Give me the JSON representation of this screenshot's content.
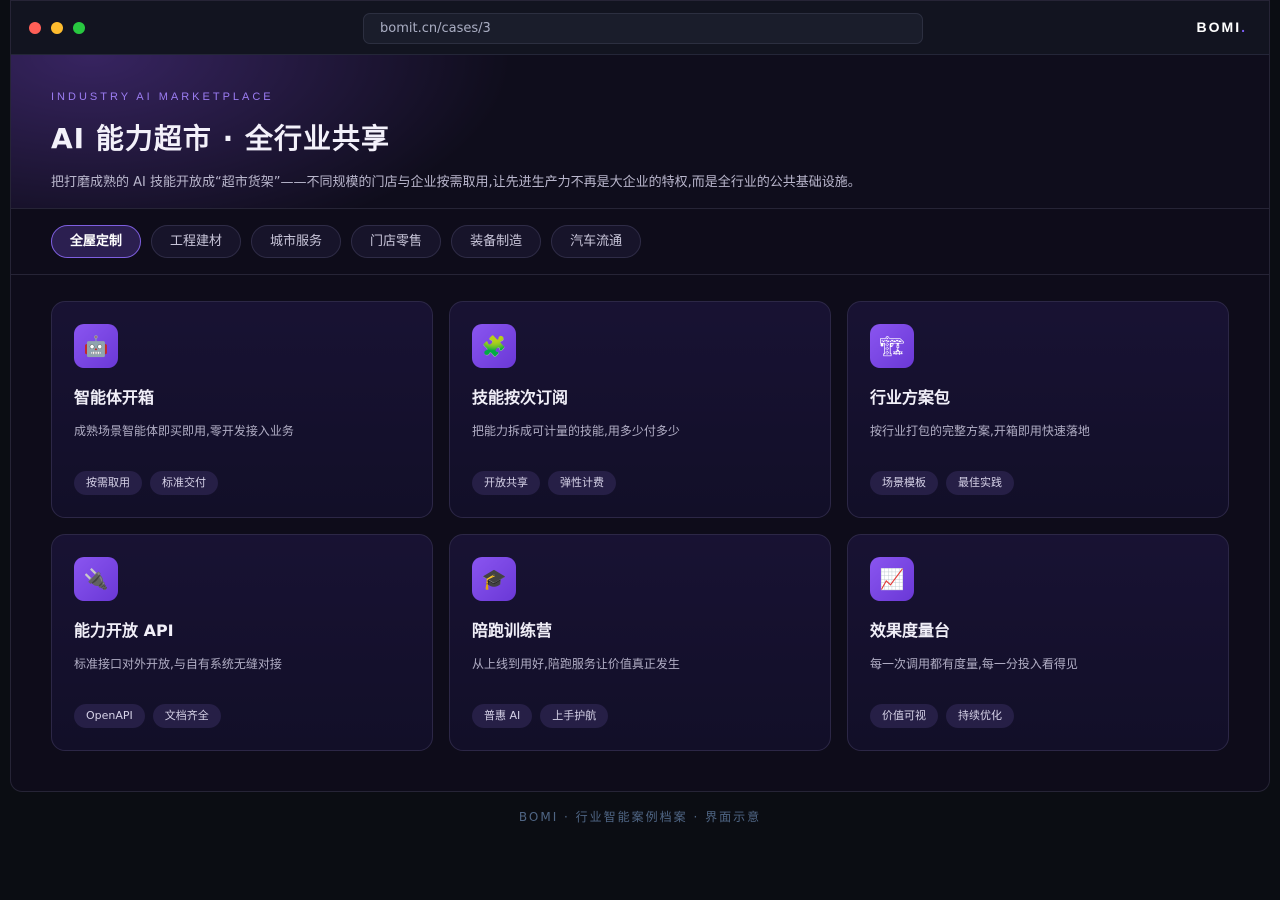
{
  "browser": {
    "url": "bomit.cn/cases/3",
    "brand": "BOMI",
    "brand_dot": "."
  },
  "hero": {
    "eyebrow": "INDUSTRY AI MARKETPLACE",
    "title": "AI 能力超市 · 全行业共享",
    "description": "把打磨成熟的 AI 技能开放成“超市货架”——不同规模的门店与企业按需取用,让先进生产力不再是大企业的特权,而是全行业的公共基础设施。"
  },
  "tabs": [
    {
      "label": "全屋定制",
      "active": true
    },
    {
      "label": "工程建材",
      "active": false
    },
    {
      "label": "城市服务",
      "active": false
    },
    {
      "label": "门店零售",
      "active": false
    },
    {
      "label": "装备制造",
      "active": false
    },
    {
      "label": "汽车流通",
      "active": false
    }
  ],
  "cards": [
    {
      "icon": "robot-icon",
      "glyph": "🤖",
      "title": "智能体开箱",
      "description": "成熟场景智能体即买即用,零开发接入业务",
      "tags": [
        "按需取用",
        "标准交付"
      ]
    },
    {
      "icon": "puzzle-icon",
      "glyph": "🧩",
      "title": "技能按次订阅",
      "description": "把能力拆成可计量的技能,用多少付多少",
      "tags": [
        "开放共享",
        "弹性计费"
      ]
    },
    {
      "icon": "crane-icon",
      "glyph": "🏗",
      "title": "行业方案包",
      "description": "按行业打包的完整方案,开箱即用快速落地",
      "tags": [
        "场景模板",
        "最佳实践"
      ]
    },
    {
      "icon": "plug-icon",
      "glyph": "🔌",
      "title": "能力开放 API",
      "description": "标准接口对外开放,与自有系统无缝对接",
      "tags": [
        "OpenAPI",
        "文档齐全"
      ]
    },
    {
      "icon": "graduation-cap-icon",
      "glyph": "🎓",
      "title": "陪跑训练营",
      "description": "从上线到用好,陪跑服务让价值真正发生",
      "tags": [
        "普惠 AI",
        "上手护航"
      ]
    },
    {
      "icon": "chart-increasing-icon",
      "glyph": "📈",
      "title": "效果度量台",
      "description": "每一次调用都有度量,每一分投入看得见",
      "tags": [
        "价值可视",
        "持续优化"
      ]
    }
  ],
  "footer": {
    "text": "BOMI · 行业智能案例档案 · 界面示意"
  }
}
